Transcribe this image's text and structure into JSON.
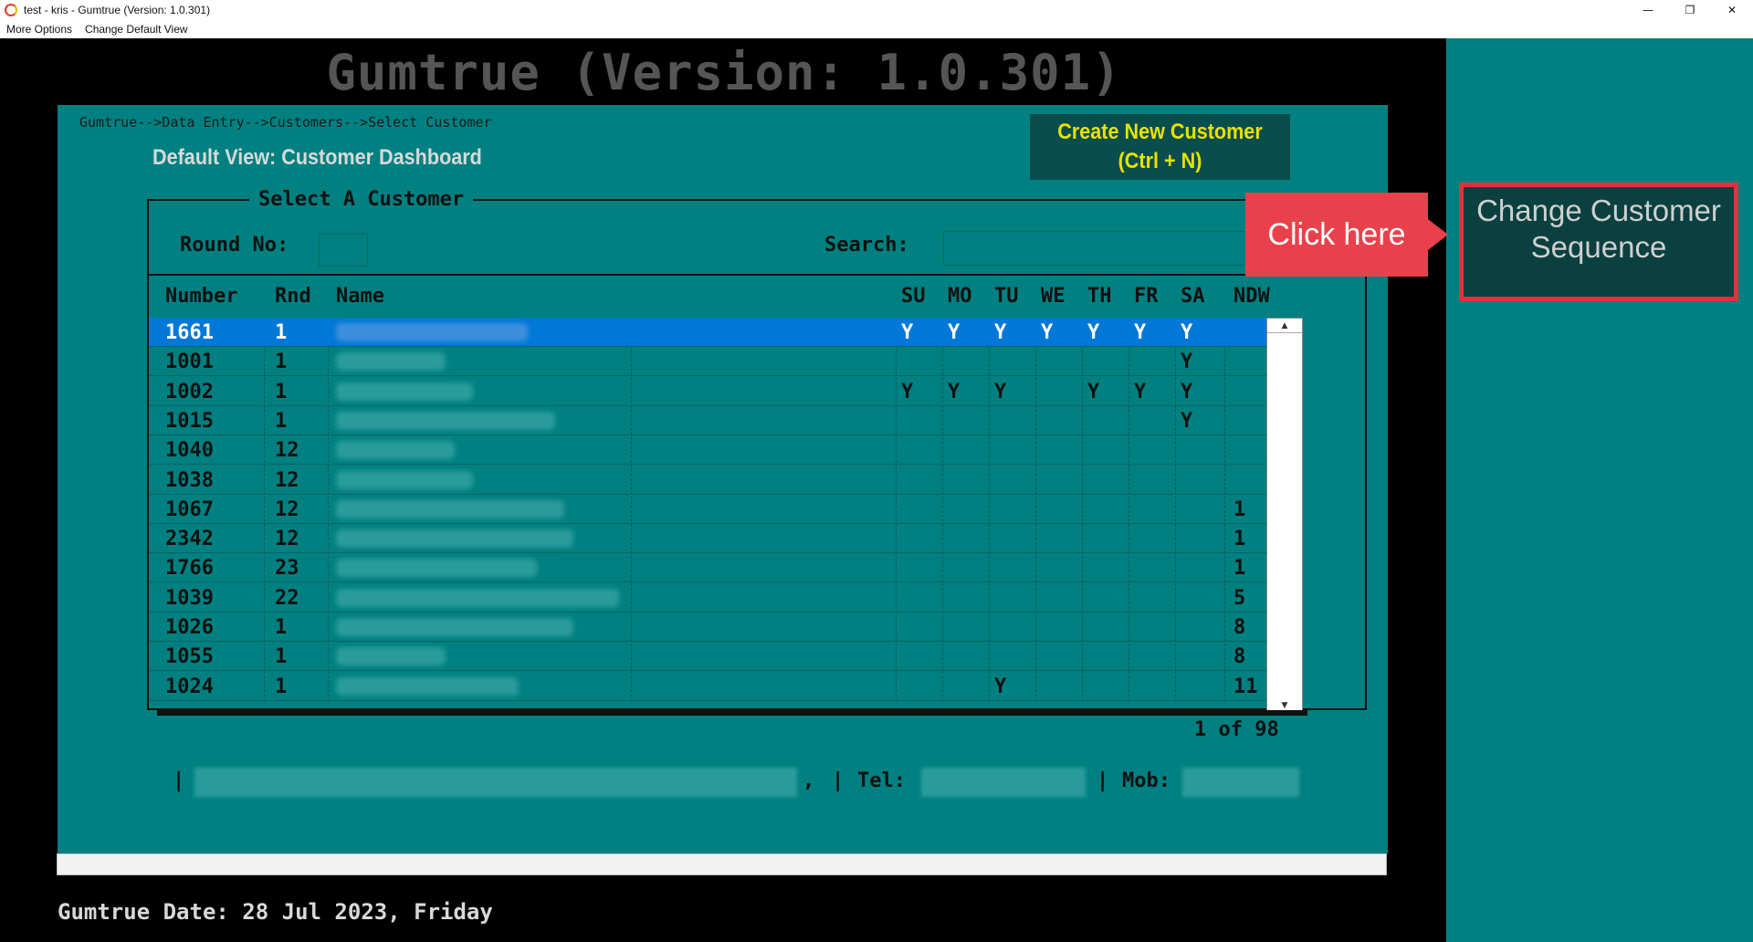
{
  "window": {
    "title": "test - kris - Gumtrue (Version: 1.0.301)",
    "controls": {
      "minimize": "—",
      "restore": "❐",
      "close": "✕"
    }
  },
  "menu": {
    "items": [
      "More Options",
      "Change Default View"
    ]
  },
  "app": {
    "title": "Gumtrue (Version: 1.0.301)",
    "breadcrumb": "Gumtrue-->Data Entry-->Customers-->Select Customer",
    "view_label": "Default View: Customer Dashboard",
    "create_button": {
      "line1": "Create New Customer",
      "line2": "(Ctrl + N)"
    }
  },
  "select_customer": {
    "group_title": "Select A Customer",
    "round_label": "Round No:",
    "round_value": "",
    "search_label": "Search:",
    "search_value": "",
    "columns": [
      "Number",
      "Rnd",
      "Name",
      "SU",
      "MO",
      "TU",
      "WE",
      "TH",
      "FR",
      "SA",
      "NDW"
    ],
    "rows": [
      {
        "number": "1661",
        "rnd": "1",
        "su": "Y",
        "mo": "Y",
        "tu": "Y",
        "we": "Y",
        "th": "Y",
        "fr": "Y",
        "sa": "Y",
        "ndw": "",
        "selected": true
      },
      {
        "number": "1001",
        "rnd": "1",
        "su": "",
        "mo": "",
        "tu": "",
        "we": "",
        "th": "",
        "fr": "",
        "sa": "Y",
        "ndw": ""
      },
      {
        "number": "1002",
        "rnd": "1",
        "su": "Y",
        "mo": "Y",
        "tu": "Y",
        "we": "",
        "th": "Y",
        "fr": "Y",
        "sa": "Y",
        "ndw": ""
      },
      {
        "number": "1015",
        "rnd": "1",
        "su": "",
        "mo": "",
        "tu": "",
        "we": "",
        "th": "",
        "fr": "",
        "sa": "Y",
        "ndw": ""
      },
      {
        "number": "1040",
        "rnd": "12",
        "su": "",
        "mo": "",
        "tu": "",
        "we": "",
        "th": "",
        "fr": "",
        "sa": "",
        "ndw": ""
      },
      {
        "number": "1038",
        "rnd": "12",
        "su": "",
        "mo": "",
        "tu": "",
        "we": "",
        "th": "",
        "fr": "",
        "sa": "",
        "ndw": ""
      },
      {
        "number": "1067",
        "rnd": "12",
        "su": "",
        "mo": "",
        "tu": "",
        "we": "",
        "th": "",
        "fr": "",
        "sa": "",
        "ndw": "1"
      },
      {
        "number": "2342",
        "rnd": "12",
        "su": "",
        "mo": "",
        "tu": "",
        "we": "",
        "th": "",
        "fr": "",
        "sa": "",
        "ndw": "1"
      },
      {
        "number": "1766",
        "rnd": "23",
        "su": "",
        "mo": "",
        "tu": "",
        "we": "",
        "th": "",
        "fr": "",
        "sa": "",
        "ndw": "1"
      },
      {
        "number": "1039",
        "rnd": "22",
        "su": "",
        "mo": "",
        "tu": "",
        "we": "",
        "th": "",
        "fr": "",
        "sa": "",
        "ndw": "5"
      },
      {
        "number": "1026",
        "rnd": "1",
        "su": "",
        "mo": "",
        "tu": "",
        "we": "",
        "th": "",
        "fr": "",
        "sa": "",
        "ndw": "8"
      },
      {
        "number": "1055",
        "rnd": "1",
        "su": "",
        "mo": "",
        "tu": "",
        "we": "",
        "th": "",
        "fr": "",
        "sa": "",
        "ndw": "8"
      },
      {
        "number": "1024",
        "rnd": "1",
        "su": "",
        "mo": "",
        "tu": "Y",
        "we": "",
        "th": "",
        "fr": "",
        "sa": "",
        "ndw": "11"
      }
    ],
    "page_count": "1 of 98"
  },
  "contact": {
    "sep1": "|",
    "comma": ",",
    "sep2": "|",
    "tel_label": "Tel:",
    "sep3": "|",
    "mob_label": "Mob:"
  },
  "date_line": "Gumtrue Date: 28 Jul 2023, Friday",
  "side": {
    "sequence_button": {
      "line1": "Change Customer",
      "line2": "Sequence"
    },
    "callout": "Click here"
  },
  "colors": {
    "panel_teal": "#008080",
    "selected_blue": "#0078d7",
    "callout_red": "#e8414c",
    "create_text": "#e7e200"
  }
}
